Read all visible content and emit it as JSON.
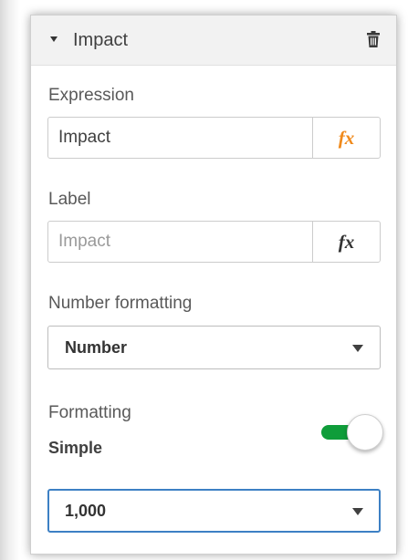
{
  "section": {
    "title": "Impact"
  },
  "expression": {
    "label": "Expression",
    "value": "Impact",
    "fx_label": "fx",
    "fx_color": "#f08a1c"
  },
  "label_field": {
    "label": "Label",
    "placeholder": "Impact",
    "fx_label": "fx",
    "fx_color": "#333333"
  },
  "number_formatting": {
    "label": "Number formatting",
    "selected": "Number"
  },
  "formatting": {
    "label": "Formatting",
    "mode": "Simple",
    "toggle_on": true,
    "toggle_color": "#0f9d3a"
  },
  "format_pattern": {
    "selected": "1,000"
  },
  "colors": {
    "focus_border": "#3d80c4",
    "header_bg": "#f2f2f2"
  }
}
